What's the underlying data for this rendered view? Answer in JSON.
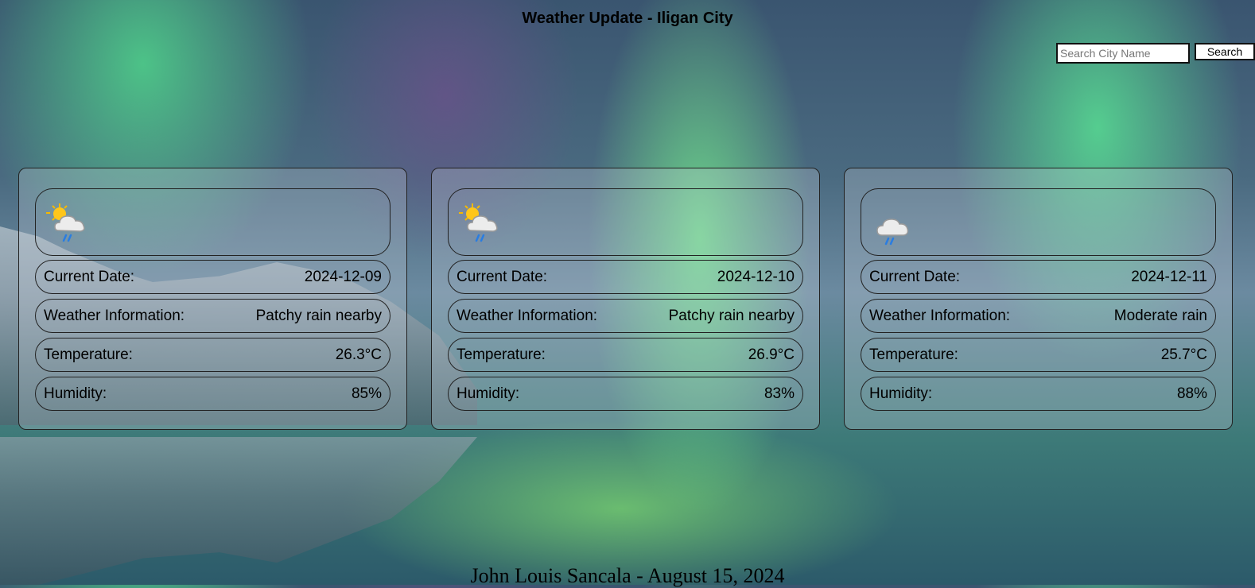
{
  "header": {
    "title": "Weather Update - Iligan City"
  },
  "search": {
    "placeholder": "Search City Name",
    "button_label": "Search"
  },
  "labels": {
    "date": "Current Date:",
    "weather": "Weather Information:",
    "temperature": "Temperature:",
    "humidity": "Humidity:"
  },
  "forecast": [
    {
      "icon": "patchy-rain-icon",
      "date": "2024-12-09",
      "weather": "Patchy rain nearby",
      "temperature": "26.3°C",
      "humidity": "85%"
    },
    {
      "icon": "patchy-rain-icon",
      "date": "2024-12-10",
      "weather": "Patchy rain nearby",
      "temperature": "26.9°C",
      "humidity": "83%"
    },
    {
      "icon": "moderate-rain-icon",
      "date": "2024-12-11",
      "weather": "Moderate rain",
      "temperature": "25.7°C",
      "humidity": "88%"
    }
  ],
  "footer": {
    "text": "John Louis Sancala - August 15, 2024"
  }
}
